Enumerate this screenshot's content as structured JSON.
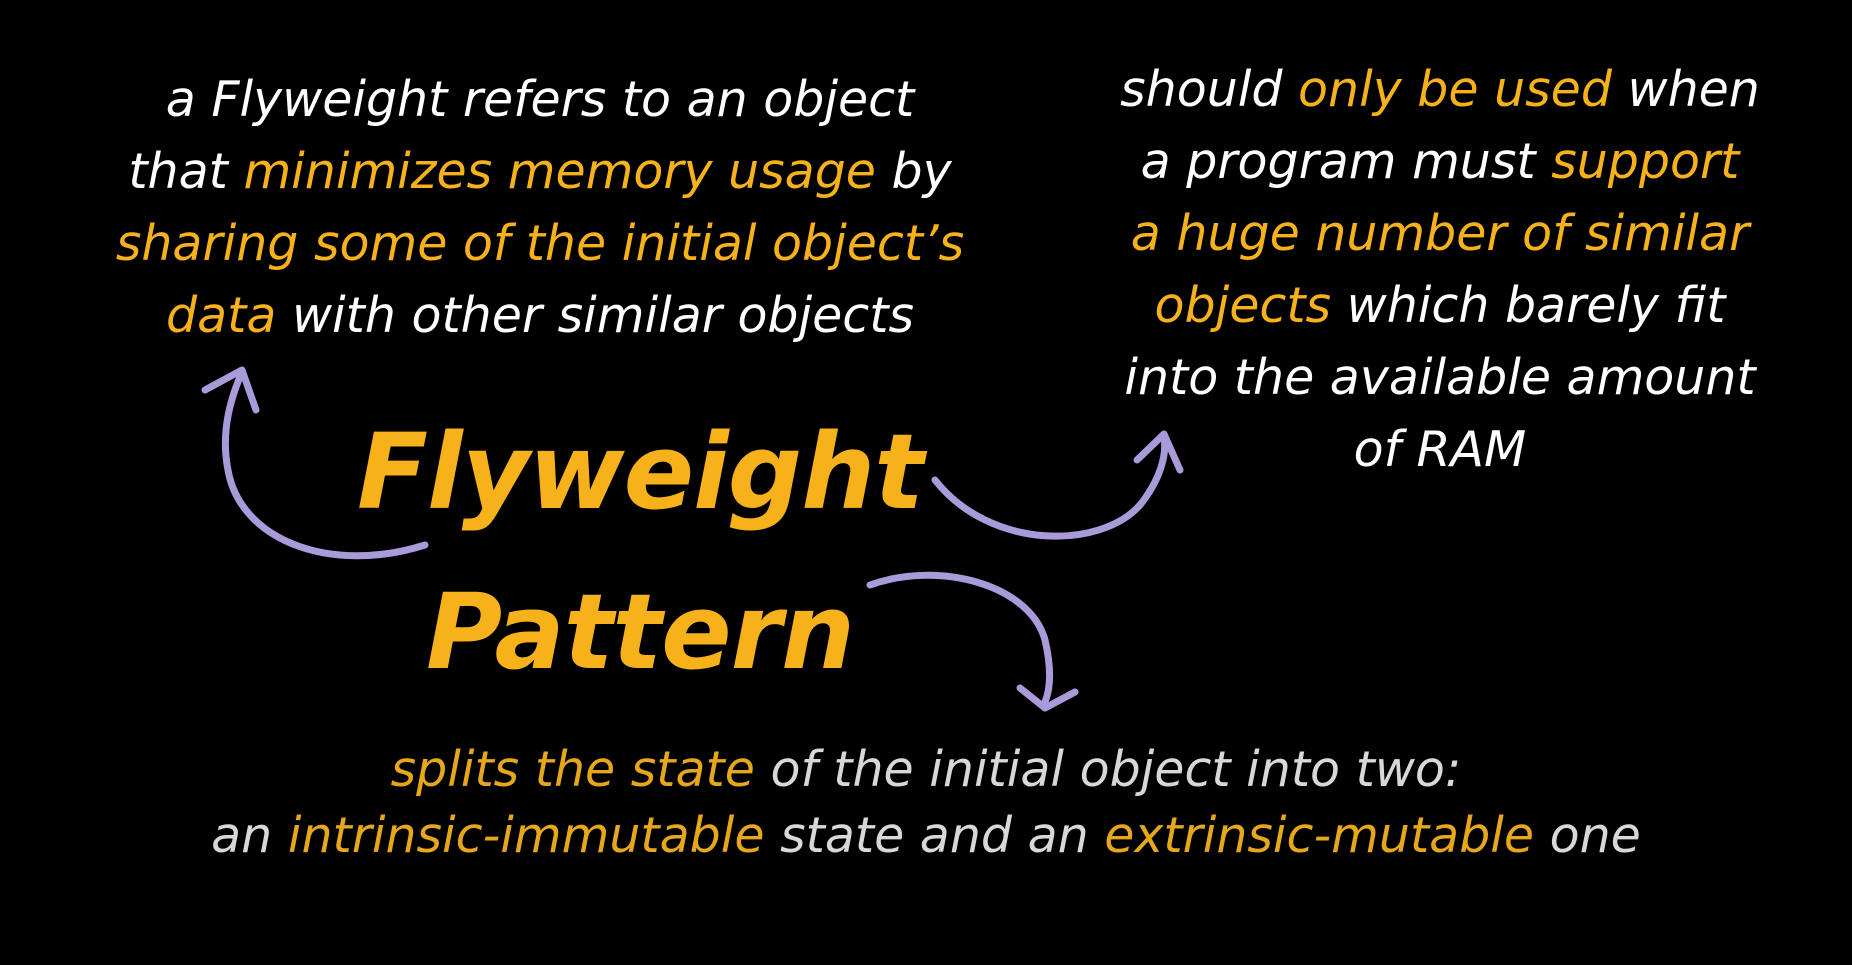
{
  "diagram": {
    "title": {
      "line1": "Flyweight",
      "line2": "Pattern"
    },
    "left": {
      "l1_a": "a Flyweight refers to an object",
      "l2_a": "that ",
      "l2_b": "minimizes memory usage",
      "l2_c": " by",
      "l3_a": "sharing some of the initial object’s",
      "l4_a": "data",
      "l4_b": " with other similar objects"
    },
    "right": {
      "l1_a": "should ",
      "l1_b": "only be used",
      "l1_c": " when",
      "l2_a": "a program must ",
      "l2_b": "support",
      "l3_a": "a huge number of similar",
      "l4_a": "objects",
      "l4_b": " which barely fit",
      "l5_a": "into the available amount",
      "l6_a": "of RAM"
    },
    "bottom": {
      "l1_a": "splits the state",
      "l1_b": " of the initial object into two:",
      "l2_a": "an ",
      "l2_b": "intrinsic-immutable",
      "l2_c": " state and an ",
      "l2_d": "extrinsic-mutable",
      "l2_e": " one"
    },
    "colors": {
      "background": "#000000",
      "highlight": "#f7b21b",
      "text": "#ffffff",
      "arrow": "#a99bd9"
    }
  }
}
